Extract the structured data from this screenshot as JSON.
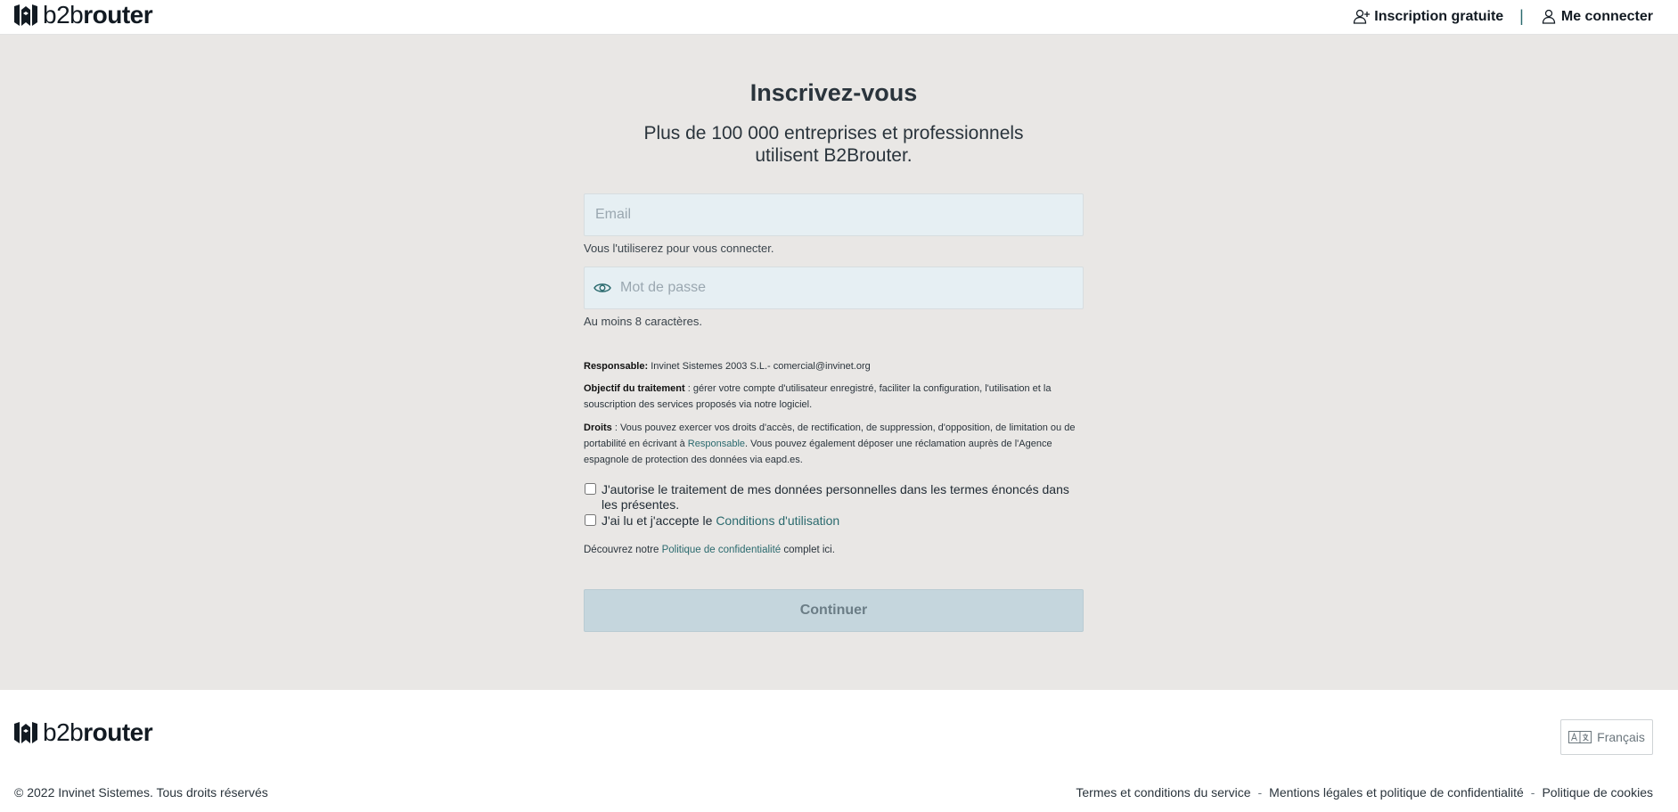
{
  "brand": {
    "light": "b2b",
    "bold": "router"
  },
  "nav": {
    "signup": "Inscription gratuite",
    "separator": "|",
    "login": "Me connecter"
  },
  "form": {
    "title": "Inscrivez-vous",
    "subtitle_line1": "Plus de 100 000 entreprises et professionnels",
    "subtitle_line2": "utilisent B2Brouter.",
    "email_placeholder": "Email",
    "email_hint": "Vous l'utiliserez pour vous connecter.",
    "password_placeholder": "Mot de passe",
    "password_hint": "Au moins 8 caractères.",
    "legal": {
      "responsable_label": "Responsable:",
      "responsable_text": " Invinet Sistemes 2003 S.L.- comercial@invinet.org",
      "objectif_label": "Objectif du traitement",
      "objectif_text": " : gérer votre compte d'utilisateur enregistré, faciliter la configuration, l'utilisation et la souscription des services proposés via notre logiciel.",
      "droits_label": "Droits",
      "droits_text_1": " : Vous pouvez exercer vos droits d'accès, de rectification, de suppression, d'opposition, de limitation ou de portabilité en écrivant à ",
      "droits_link": "Responsable",
      "droits_text_2": ". Vous pouvez également déposer une réclamation auprès de l'Agence espagnole de protection des données via eapd.es."
    },
    "consent_data": "J'autorise le traitement de mes données personnelles dans les termes énoncés dans les présentes.",
    "consent_terms_prefix": "J'ai lu et j'accepte le ",
    "consent_terms_link": "Conditions d'utilisation",
    "discover_prefix": "Découvrez notre ",
    "discover_link": "Politique de confidentialité",
    "discover_suffix": " complet ici.",
    "submit": "Continuer"
  },
  "footer": {
    "language": "Français",
    "copyright": "© 2022 Invinet Sistemes. Tous droits réservés",
    "links": [
      "Termes et conditions du service",
      "Mentions légales et politique de confidentialité",
      "Politique de cookies"
    ],
    "link_separator": "-"
  },
  "icons": {
    "brand_mark": "b2brouter-logo-icon",
    "signup": "user-plus-icon",
    "login": "user-icon",
    "password_toggle": "eye-icon",
    "language": "translate-icon"
  },
  "colors": {
    "accent": "#2b6a6e",
    "background": "#e9e7e5",
    "input_bg": "#e6eff3",
    "button_disabled": "#c5d6dd"
  }
}
